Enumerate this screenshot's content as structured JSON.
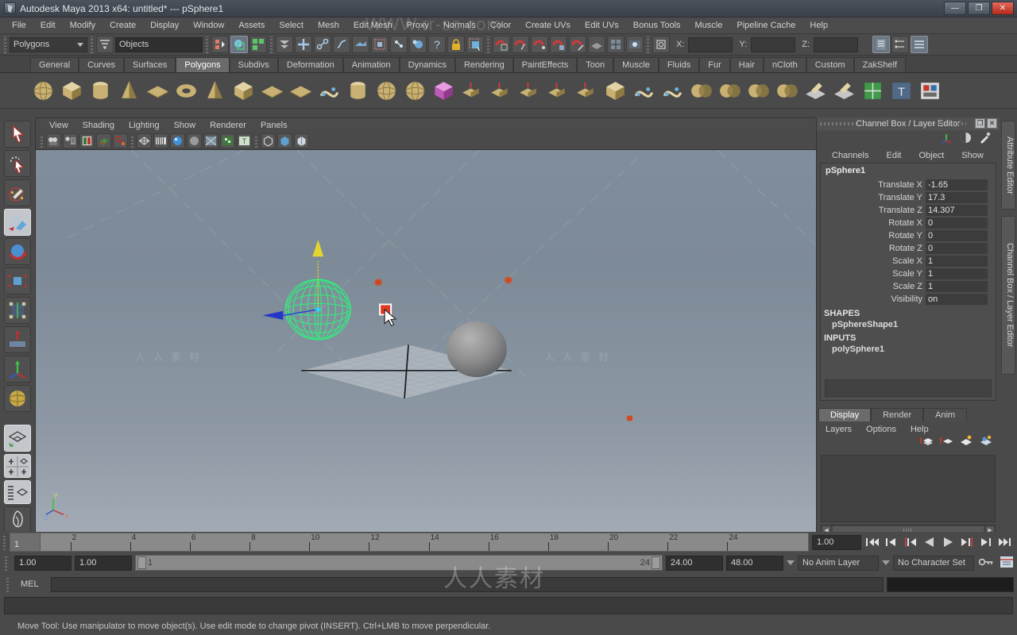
{
  "window": {
    "title": "Autodesk Maya 2013 x64: untitled*   ---   pSphere1",
    "minimize": "—",
    "maximize": "❐",
    "close": "✕"
  },
  "menubar": {
    "items": [
      "File",
      "Edit",
      "Modify",
      "Create",
      "Display",
      "Window",
      "Assets",
      "Select",
      "Mesh",
      "Edit Mesh",
      "Proxy",
      "Normals",
      "Color",
      "Create UVs",
      "Edit UVs",
      "Bonus Tools",
      "Muscle",
      "Pipeline Cache",
      "Help"
    ]
  },
  "statusline": {
    "menuset": "Polygons",
    "object_field": "Objects",
    "coord_labels": {
      "x": "X:",
      "y": "Y:",
      "z": "Z:"
    },
    "coord_values": {
      "x": "",
      "y": "",
      "z": ""
    }
  },
  "shelf": {
    "tabs": [
      "General",
      "Curves",
      "Surfaces",
      "Polygons",
      "Subdivs",
      "Deformation",
      "Animation",
      "Dynamics",
      "Rendering",
      "PaintEffects",
      "Toon",
      "Muscle",
      "Fluids",
      "Fur",
      "Hair",
      "nCloth",
      "Custom",
      "ZakShelf"
    ],
    "active_tab": "Polygons",
    "icons": [
      "poly-sphere-icon",
      "poly-cube-icon",
      "poly-cylinder-icon",
      "poly-cone-icon",
      "poly-plane-icon",
      "poly-torus-icon",
      "poly-pyramid-icon",
      "poly-prism-icon",
      "poly-disc-icon",
      "poly-soccer-ball-icon",
      "poly-helix-icon",
      "poly-gear-icon",
      "poly-sphere2-icon",
      "poly-platonic-icon",
      "poly-cube-pink-icon",
      "poly-extrude-icon",
      "poly-bevel-icon",
      "poly-bridge-icon",
      "poly-append-icon",
      "poly-wedge-icon",
      "poly-duplicate-icon",
      "poly-connect-icon",
      "poly-crease-icon",
      "poly-booleans-icon",
      "poly-combine-icon",
      "poly-smooth-icon",
      "poly-mirror-icon",
      "poly-sculpt-icon",
      "poly-quaddraw-icon",
      "poly-uv-icon",
      "poly-text-icon",
      "poly-render-icon"
    ]
  },
  "toolbox": {
    "tools": [
      "select-tool",
      "lasso-select-tool",
      "paint-select-tool",
      "move-tool",
      "rotate-tool",
      "scale-tool",
      "universal-manipulator-tool",
      "soft-modification-tool",
      "show-manipulator-tool",
      "last-tool-used"
    ],
    "layouts": [
      "single-perspective-layout",
      "four-view-layout",
      "outliner-persp-layout",
      "hypershade-layout"
    ]
  },
  "viewport": {
    "menus": [
      "View",
      "Shading",
      "Lighting",
      "Show",
      "Renderer",
      "Panels"
    ],
    "toolbar_icons": [
      "camera-attributes-icon",
      "camera-bookmarks-icon",
      "image-plane-icon",
      "two-sided-lighting-icon",
      "grid-toggle-icon",
      "wireframe-shading-icon",
      "smooth-shade-icon",
      "smooth-shade-all-icon",
      "hardware-texturing-icon",
      "wireframe-on-shaded-icon",
      "xray-icon",
      "xray-joints-icon",
      "text-icon",
      "isolate-select-icon",
      "shading-smooth-icon",
      "display-toggle-icon"
    ],
    "axis_labels": {
      "y": "y",
      "x": "x",
      "z": "z"
    },
    "objects": [
      "selected-sphere-wireframe",
      "move-manipulator",
      "reference-plane-grid",
      "shaded-sphere"
    ]
  },
  "channelbox": {
    "panel_title": "Channel Box / Layer Editor",
    "menus": [
      "Channels",
      "Edit",
      "Object",
      "Show"
    ],
    "node_name": "pSphere1",
    "attributes": [
      {
        "label": "Translate X",
        "value": "-1.65"
      },
      {
        "label": "Translate Y",
        "value": "17.3"
      },
      {
        "label": "Translate Z",
        "value": "14.307"
      },
      {
        "label": "Rotate X",
        "value": "0"
      },
      {
        "label": "Rotate Y",
        "value": "0"
      },
      {
        "label": "Rotate Z",
        "value": "0"
      },
      {
        "label": "Scale X",
        "value": "1"
      },
      {
        "label": "Scale Y",
        "value": "1"
      },
      {
        "label": "Scale Z",
        "value": "1"
      },
      {
        "label": "Visibility",
        "value": "on"
      }
    ],
    "sections": [
      {
        "header": "SHAPES",
        "items": [
          "pSphereShape1"
        ]
      },
      {
        "header": "INPUTS",
        "items": [
          "polySphere1"
        ]
      }
    ]
  },
  "layereditor": {
    "tabs": [
      "Display",
      "Render",
      "Anim"
    ],
    "active_tab": "Display",
    "menus": [
      "Layers",
      "Options",
      "Help"
    ],
    "icons": [
      "new-layer-from-selected-icon",
      "new-layer-icon",
      "new-render-layer-icon",
      "new-render-pass-icon"
    ]
  },
  "vertical_tabs": [
    "Attribute Editor",
    "Channel Box / Layer Editor"
  ],
  "timeslider": {
    "current_frame": "1",
    "ticks": [
      "2",
      "4",
      "6",
      "8",
      "10",
      "12",
      "14",
      "16",
      "18",
      "20",
      "22",
      "24"
    ],
    "frame_field": "1.00",
    "playback_buttons": [
      "go-to-start-icon",
      "step-back-key-icon",
      "step-back-frame-icon",
      "play-backwards-icon",
      "play-forwards-icon",
      "step-forward-frame-icon",
      "step-forward-key-icon",
      "go-to-end-icon"
    ]
  },
  "rangeslider": {
    "anim_start": "1.00",
    "anim_start2": "1.00",
    "range_start_label": "1",
    "range_end_label": "24",
    "range_end": "24.00",
    "anim_end": "48.00",
    "anim_layer": "No Anim Layer",
    "character_set": "No Character Set"
  },
  "commandline": {
    "label": "MEL",
    "input_value": "",
    "placeholder": ""
  },
  "helpline": {
    "message": "Move Tool: Use manipulator to move object(s). Use edit mode to change pivot (INSERT).  Ctrl+LMB to move perpendicular."
  },
  "watermarks": {
    "top": "WWW.rr-sc.com",
    "items": [
      "人 人 素 材",
      "人 人 素 材",
      "人 人 素 材",
      "人 人 素 材",
      "人 人 素 材",
      "人 人 素 材"
    ],
    "bottom": "人人素材"
  },
  "colors": {
    "accent_green": "#27e07a",
    "manip_x": "#e03b22",
    "manip_y": "#ded22a",
    "manip_z": "#2b3fd8",
    "panel_bg": "#4a4a4a"
  }
}
